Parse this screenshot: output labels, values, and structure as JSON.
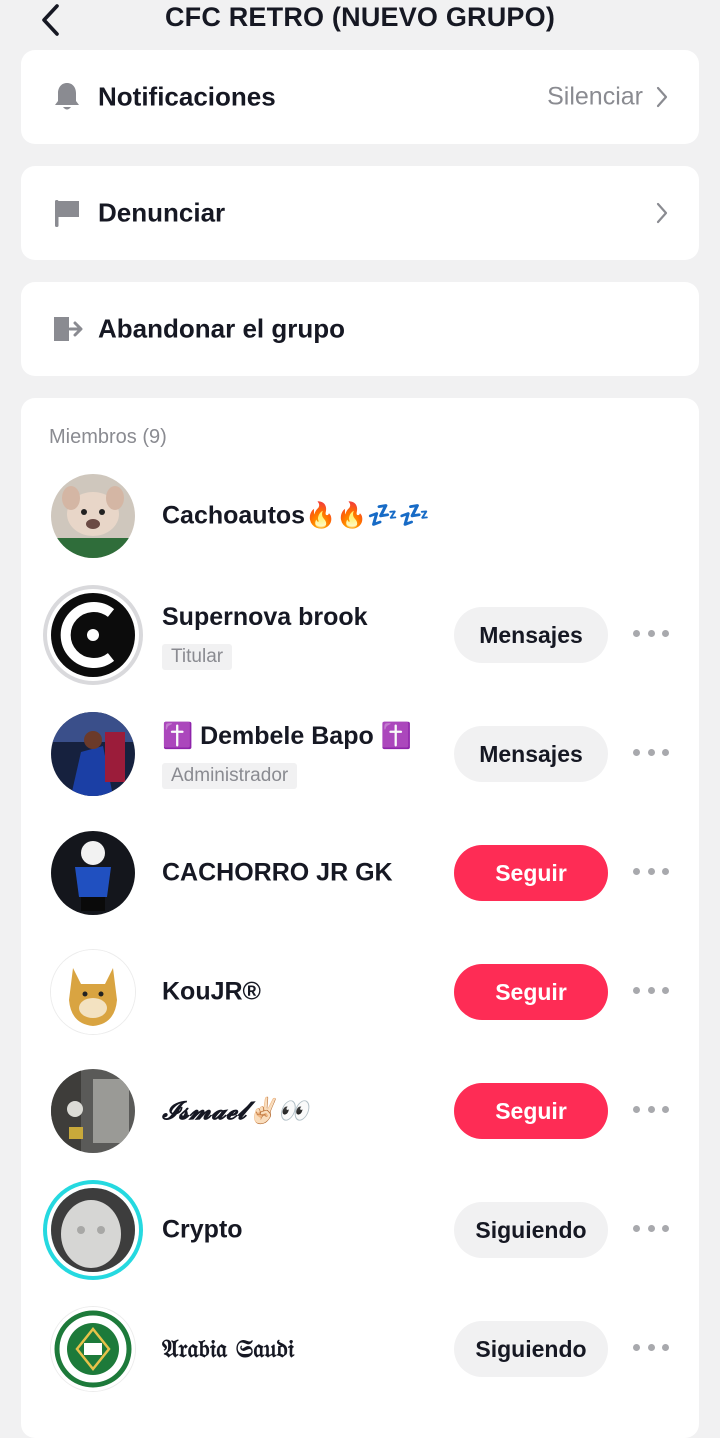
{
  "header": {
    "title": "CFC RETRO (NUEVO GRUPO)"
  },
  "settings": {
    "notifications": {
      "label": "Notificaciones",
      "value": "Silenciar"
    },
    "report": {
      "label": "Denunciar"
    },
    "leave": {
      "label": "Abandonar el grupo"
    }
  },
  "members": {
    "title": "Miembros (9)",
    "list": [
      {
        "name": "Cachoautos🔥🔥💤💤",
        "role": "",
        "button": "",
        "button_style": ""
      },
      {
        "name": "Supernova brook",
        "role": "Titular",
        "button": "Mensajes",
        "button_style": "gray"
      },
      {
        "name": "✝️ Dembele Bapo ✝️",
        "role": "Administrador",
        "button": "Mensajes",
        "button_style": "gray"
      },
      {
        "name": "CACHORRO JR GK",
        "role": "",
        "button": "Seguir",
        "button_style": "red"
      },
      {
        "name": "KouJR®",
        "role": "",
        "button": "Seguir",
        "button_style": "red"
      },
      {
        "name": "𝓘𝓼𝓶𝓪𝓮𝓵✌🏻👀",
        "role": "",
        "button": "Seguir",
        "button_style": "red"
      },
      {
        "name": "Crypto",
        "role": "",
        "button": "Siguiendo",
        "button_style": "gray"
      },
      {
        "name": "𝔄𝔯𝔞𝔟𝔦𝔞 𝔖𝔞𝔲𝔡𝔦",
        "role": "",
        "button": "Siguiendo",
        "button_style": "gray"
      }
    ]
  },
  "colors": {
    "accent": "#fe2c55",
    "background": "#f1f1f2",
    "muted_text": "#8a8b91",
    "ring_teal": "#25d9e0"
  },
  "icons": [
    "back-icon",
    "bell-icon",
    "flag-icon",
    "leave-icon",
    "chevron-right-icon",
    "more-icon"
  ]
}
